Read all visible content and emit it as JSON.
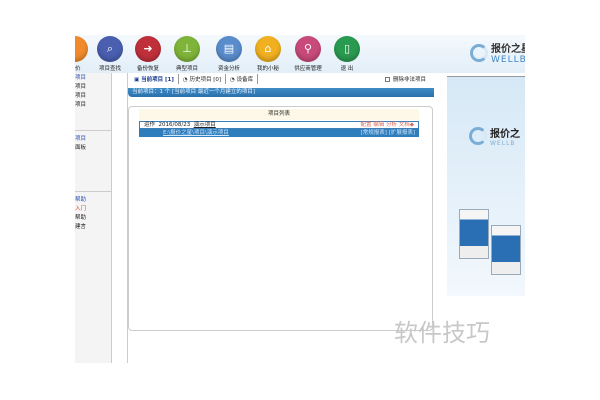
{
  "toolbar": {
    "items": [
      {
        "label": "报价",
        "icon": "quote-icon",
        "color": "#f08a2c"
      },
      {
        "label": "项目查找",
        "icon": "search-project-icon",
        "color": "#4a5fb0"
      },
      {
        "label": "备份恢复",
        "icon": "backup-restore-icon",
        "color": "#c0303a"
      },
      {
        "label": "典型项目",
        "icon": "stamp-icon",
        "color": "#7fb43a"
      },
      {
        "label": "资金分析",
        "icon": "document-analysis-icon",
        "color": "#5a8ccc"
      },
      {
        "label": "我的小秘",
        "icon": "home-icon",
        "color": "#f0b020"
      },
      {
        "label": "供应商管理",
        "icon": "supplier-search-icon",
        "color": "#c84a7a"
      },
      {
        "label": "退 出",
        "icon": "exit-icon",
        "color": "#2a9a50"
      }
    ]
  },
  "logo": {
    "name": "报价之星",
    "sub": "WELLBI"
  },
  "sidebar": {
    "items": [
      "项目",
      "项目",
      "项目",
      "项目",
      "项目",
      "面板",
      "帮助",
      "入门",
      "帮助",
      "建言"
    ]
  },
  "tabs": [
    {
      "label": "当前项目 [1]"
    },
    {
      "label": "历史项目 [0]"
    },
    {
      "label": "设备库"
    }
  ],
  "delete_illegal": {
    "label": "删除非法项目",
    "checked": false
  },
  "status_bar": "当前项目：1 个    [当前项目 最近一个月建立的项目]",
  "list": {
    "title": "项目列表",
    "rows": [
      {
        "status": "运作",
        "date": "2016/08/23",
        "name": "演示项目",
        "actions": "配置 编辑 分析 文档◆",
        "path": "E:\\报价之星\\项目\\演示项目",
        "reports": "[常规报表] [扩展报表]"
      }
    ]
  },
  "promo": {
    "name": "报价之",
    "sub": "WELLB"
  },
  "watermark": "软件技巧"
}
